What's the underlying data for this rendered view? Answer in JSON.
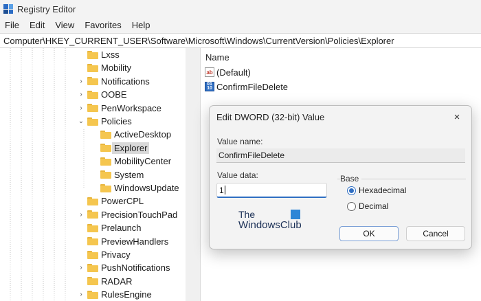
{
  "window": {
    "title": "Registry Editor"
  },
  "menu": [
    "File",
    "Edit",
    "View",
    "Favorites",
    "Help"
  ],
  "address": "Computer\\HKEY_CURRENT_USER\\Software\\Microsoft\\Windows\\CurrentVersion\\Policies\\Explorer",
  "tree": {
    "items": [
      {
        "label": "Lxss",
        "expander": ""
      },
      {
        "label": "Mobility",
        "expander": ""
      },
      {
        "label": "Notifications",
        "expander": "›"
      },
      {
        "label": "OOBE",
        "expander": "›"
      },
      {
        "label": "PenWorkspace",
        "expander": "›"
      },
      {
        "label": "Policies",
        "expander": "⌄"
      },
      {
        "label": "ActiveDesktop",
        "expander": ""
      },
      {
        "label": "Explorer",
        "expander": ""
      },
      {
        "label": "MobilityCenter",
        "expander": ""
      },
      {
        "label": "System",
        "expander": ""
      },
      {
        "label": "WindowsUpdate",
        "expander": ""
      },
      {
        "label": "PowerCPL",
        "expander": ""
      },
      {
        "label": "PrecisionTouchPad",
        "expander": "›"
      },
      {
        "label": "Prelaunch",
        "expander": ""
      },
      {
        "label": "PreviewHandlers",
        "expander": ""
      },
      {
        "label": "Privacy",
        "expander": ""
      },
      {
        "label": "PushNotifications",
        "expander": "›"
      },
      {
        "label": "RADAR",
        "expander": ""
      },
      {
        "label": "RulesEngine",
        "expander": "›"
      }
    ],
    "selected": "Explorer"
  },
  "list": {
    "header": "Name",
    "rows": [
      {
        "icon": "ab",
        "name": "(Default)"
      },
      {
        "icon": "binary",
        "name": "ConfirmFileDelete"
      }
    ]
  },
  "dialog": {
    "title": "Edit DWORD (32-bit) Value",
    "close_icon": "×",
    "value_name_label": "Value name:",
    "value_name": "ConfirmFileDelete",
    "value_data_label": "Value data:",
    "value_data": "1",
    "base_label": "Base",
    "base_options": [
      "Hexadecimal",
      "Decimal"
    ],
    "base_selected": "Hexadecimal",
    "ok_label": "OK",
    "cancel_label": "Cancel"
  },
  "watermark": {
    "line1": "The",
    "line2": "WindowsClub"
  }
}
